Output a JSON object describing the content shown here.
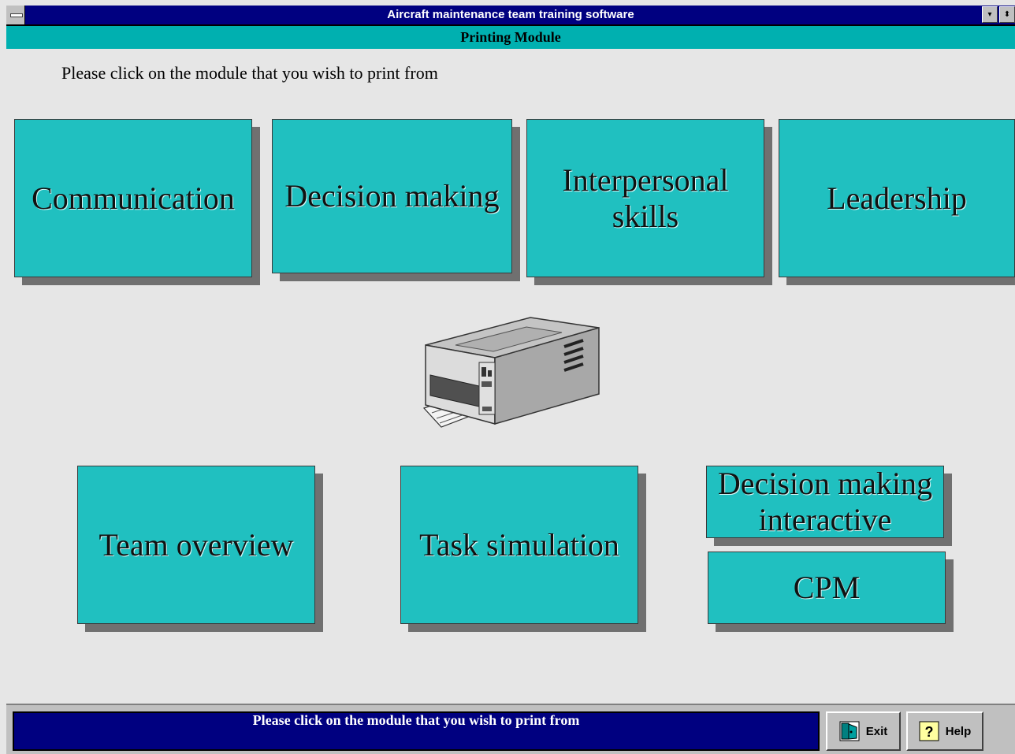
{
  "window": {
    "title": "Aircraft maintenance team training software",
    "minimize_glyph": "▾",
    "maximize_glyph": "⬍"
  },
  "module_bar": {
    "title": "Printing Module"
  },
  "instruction": "Please click on the module that you wish to print from",
  "modules_top": [
    {
      "label": "Communication"
    },
    {
      "label": "Decision making"
    },
    {
      "label": "Interpersonal\nskills"
    },
    {
      "label": "Leadership"
    }
  ],
  "modules_bottom": [
    {
      "label": "Team overview"
    },
    {
      "label": "Task simulation"
    },
    {
      "label": "Decision making\ninteractive"
    },
    {
      "label": "CPM"
    }
  ],
  "status": {
    "text": "Please click on the module that you wish to print from"
  },
  "buttons": {
    "exit": "Exit",
    "help": "Help"
  },
  "icons": {
    "exit": "exit-icon",
    "help": "help-icon",
    "printer": "printer-icon"
  },
  "colors": {
    "titlebar": "#000080",
    "module_bar": "#00b0b0",
    "tile": "#20c0c0",
    "background": "#e6e6e6"
  }
}
